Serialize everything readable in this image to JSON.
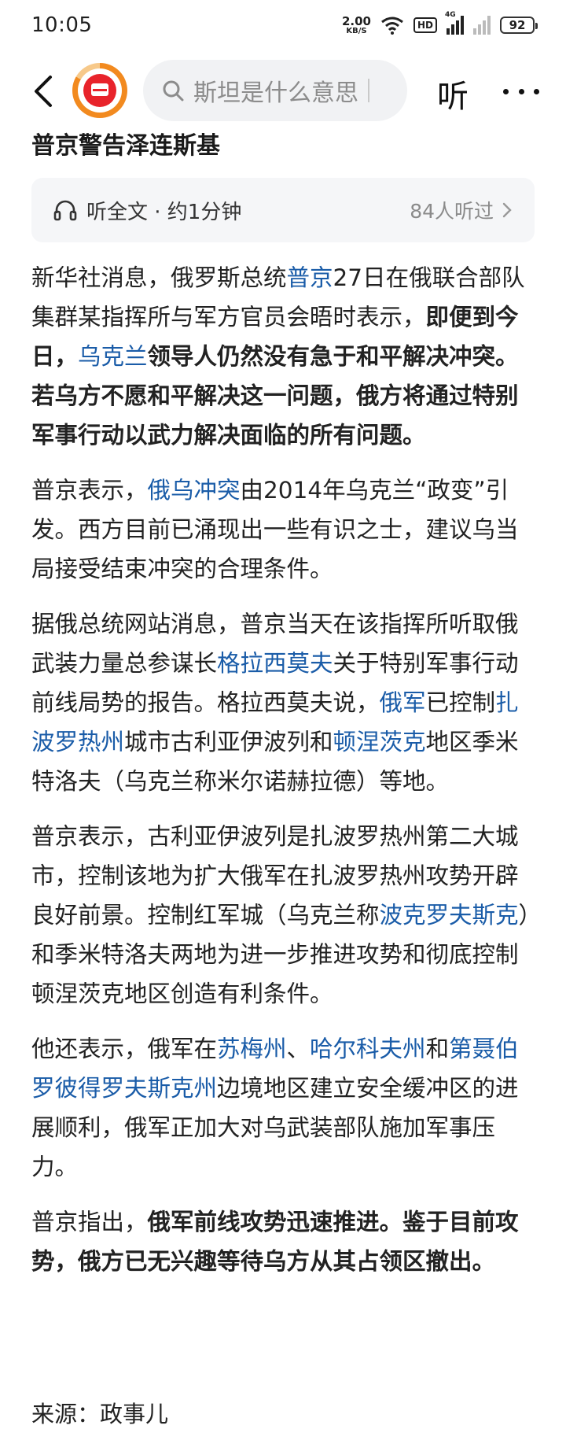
{
  "status": {
    "time": "10:05",
    "netspeed_value": "2.00",
    "netspeed_unit": "KB/S",
    "hd": "HD",
    "network_tag": "4G",
    "battery": "92"
  },
  "topbar": {
    "search_text": "斯坦是什么意思",
    "listen_label": "听"
  },
  "article": {
    "title": "普京警告泽连斯基",
    "listen_card": {
      "label": "听全文 · 约1分钟",
      "count": "84人听过"
    },
    "p1": {
      "s1": "新华社消息，俄罗斯总统",
      "link1": "普京",
      "s2": "27日在俄联合部队集群某指挥所与军方官员会晤时表示，",
      "b1": "即便到今日，",
      "link2": "乌克兰",
      "b2": "领导人仍然没有急于和平解决冲突。若乌方不愿和平解决这一问题，俄方将通过特别军事行动以武力解决面临的所有问题。"
    },
    "p2": {
      "s1": "普京表示，",
      "link1": "俄乌冲突",
      "s2": "由2014年乌克兰“政变”引发。西方目前已涌现出一些有识之士，建议乌当局接受结束冲突的合理条件。"
    },
    "p3": {
      "s1": "据俄总统网站消息，普京当天在该指挥所听取俄武装力量总参谋长",
      "link1": "格拉西莫夫",
      "s2": "关于特别军事行动前线局势的报告。格拉西莫夫说，",
      "link2": "俄军",
      "s3": "已控制",
      "link3": "扎波罗热州",
      "s4": "城市古利亚伊波列和",
      "link4": "顿涅茨克",
      "s5": "地区季米特洛夫（乌克兰称米尔诺赫拉德）等地。"
    },
    "p4": {
      "s1": "普京表示，古利亚伊波列是扎波罗热州第二大城市，控制该地为扩大俄军在扎波罗热州攻势开辟良好前景。控制红军城（乌克兰称",
      "link1": "波克罗夫斯克",
      "s2": "）和季米特洛夫两地为进一步推进攻势和彻底控制顿涅茨克地区创造有利条件。"
    },
    "p5": {
      "s1": "他还表示，俄军在",
      "link1": "苏梅州",
      "s2": "、",
      "link2": "哈尔科夫州",
      "s3": "和",
      "link3": "第聂伯罗彼得罗夫斯克州",
      "s4": "边境地区建立安全缓冲区的进展顺利，俄军正加大对乌武装部队施加军事压力。"
    },
    "p6": {
      "s1": "普京指出，",
      "b1": "俄军前线攻势迅速推进。鉴于目前攻势，俄方已无兴趣等待乌方从其占领区撤出。"
    },
    "source": "来源：政事儿"
  },
  "colors": {
    "link": "#1a5ca8",
    "logo_red": "#e8232b",
    "logo_orange": "#f28a1f"
  }
}
